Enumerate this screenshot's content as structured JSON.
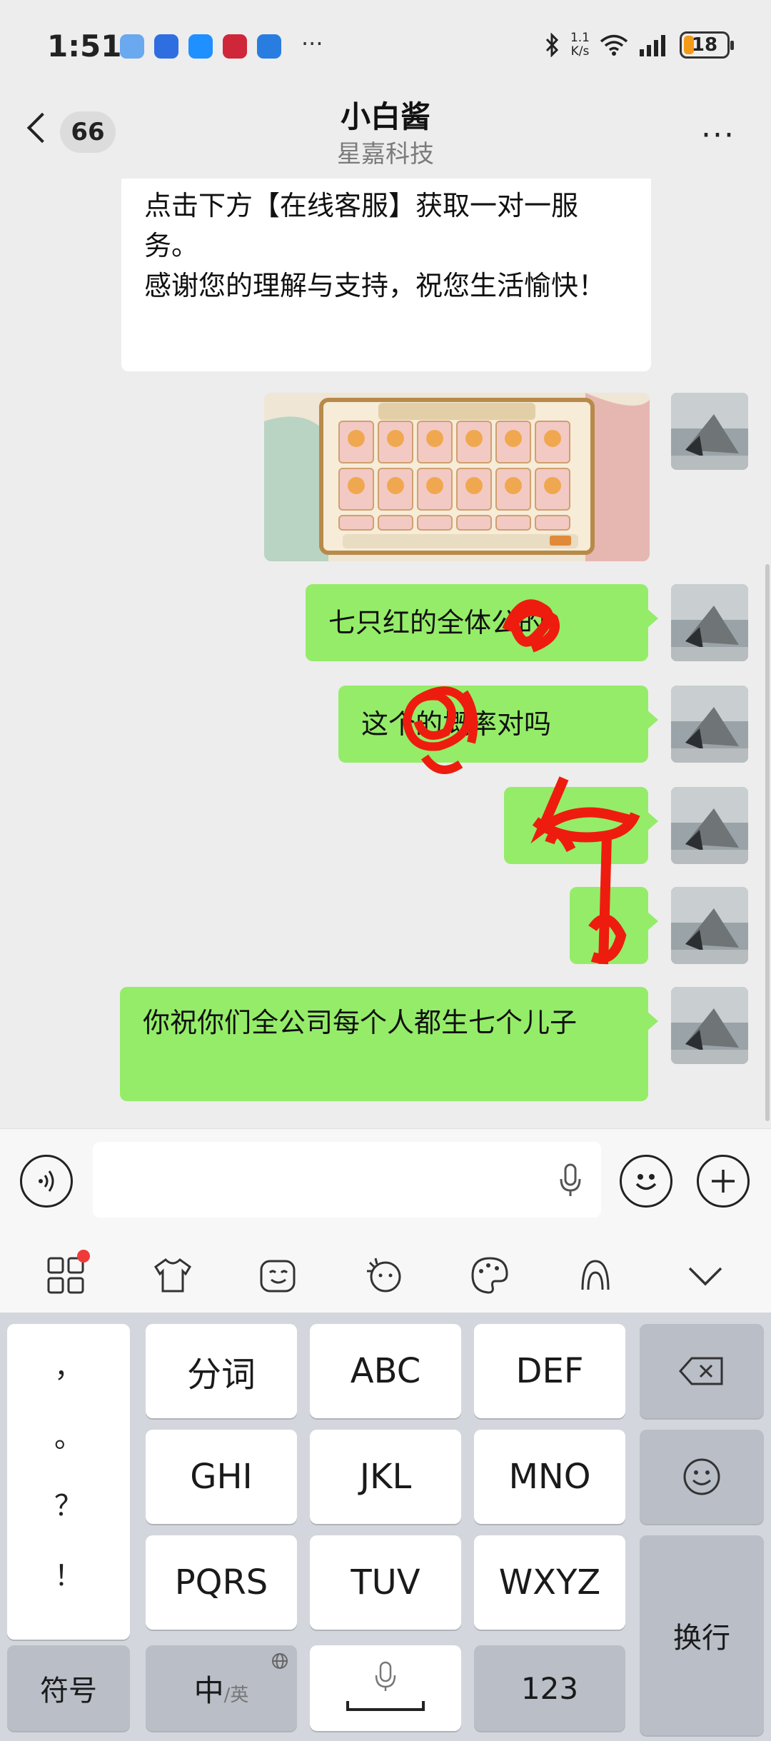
{
  "status_bar": {
    "time": "1:51",
    "more": "···",
    "net_speed": "1.1",
    "net_unit": "K/s",
    "signal_label": "6",
    "battery": "18",
    "app_icon_colors": [
      "#6aa8f0",
      "#2f6ee0",
      "#1e90ff",
      "#d0263a",
      "#2a7de0"
    ]
  },
  "header": {
    "back_count": "66",
    "title": "小白酱",
    "subtitle": "星嘉科技"
  },
  "messages": [
    {
      "type": "text",
      "side": "left",
      "text": "点击下方【在线客服】获取一对一服务。\n感谢您的理解与支持，祝您生活愉快！"
    },
    {
      "type": "image",
      "side": "right",
      "description_tags": [
        "game-screenshot"
      ]
    },
    {
      "type": "text",
      "side": "right",
      "text": "七只红的全体公的"
    },
    {
      "type": "text",
      "side": "right",
      "text": "这个的概率对吗"
    },
    {
      "type": "text",
      "side": "right",
      "text": ""
    },
    {
      "type": "text",
      "side": "right",
      "text": ""
    },
    {
      "type": "text",
      "side": "right",
      "text": "你祝你们全公司每个人都生七个儿子"
    }
  ],
  "input": {
    "placeholder": ""
  },
  "keyboard": {
    "punctuation": [
      "，",
      "。",
      "？",
      "！"
    ],
    "row1": [
      "分词",
      "ABC",
      "DEF"
    ],
    "row2": [
      "GHI",
      "JKL",
      "MNO"
    ],
    "row3": [
      "PQRS",
      "TUV",
      "WXYZ"
    ],
    "symbols": "符号",
    "lang": "中",
    "lang_sub": "/英",
    "numbers": "123",
    "enter": "换行"
  }
}
